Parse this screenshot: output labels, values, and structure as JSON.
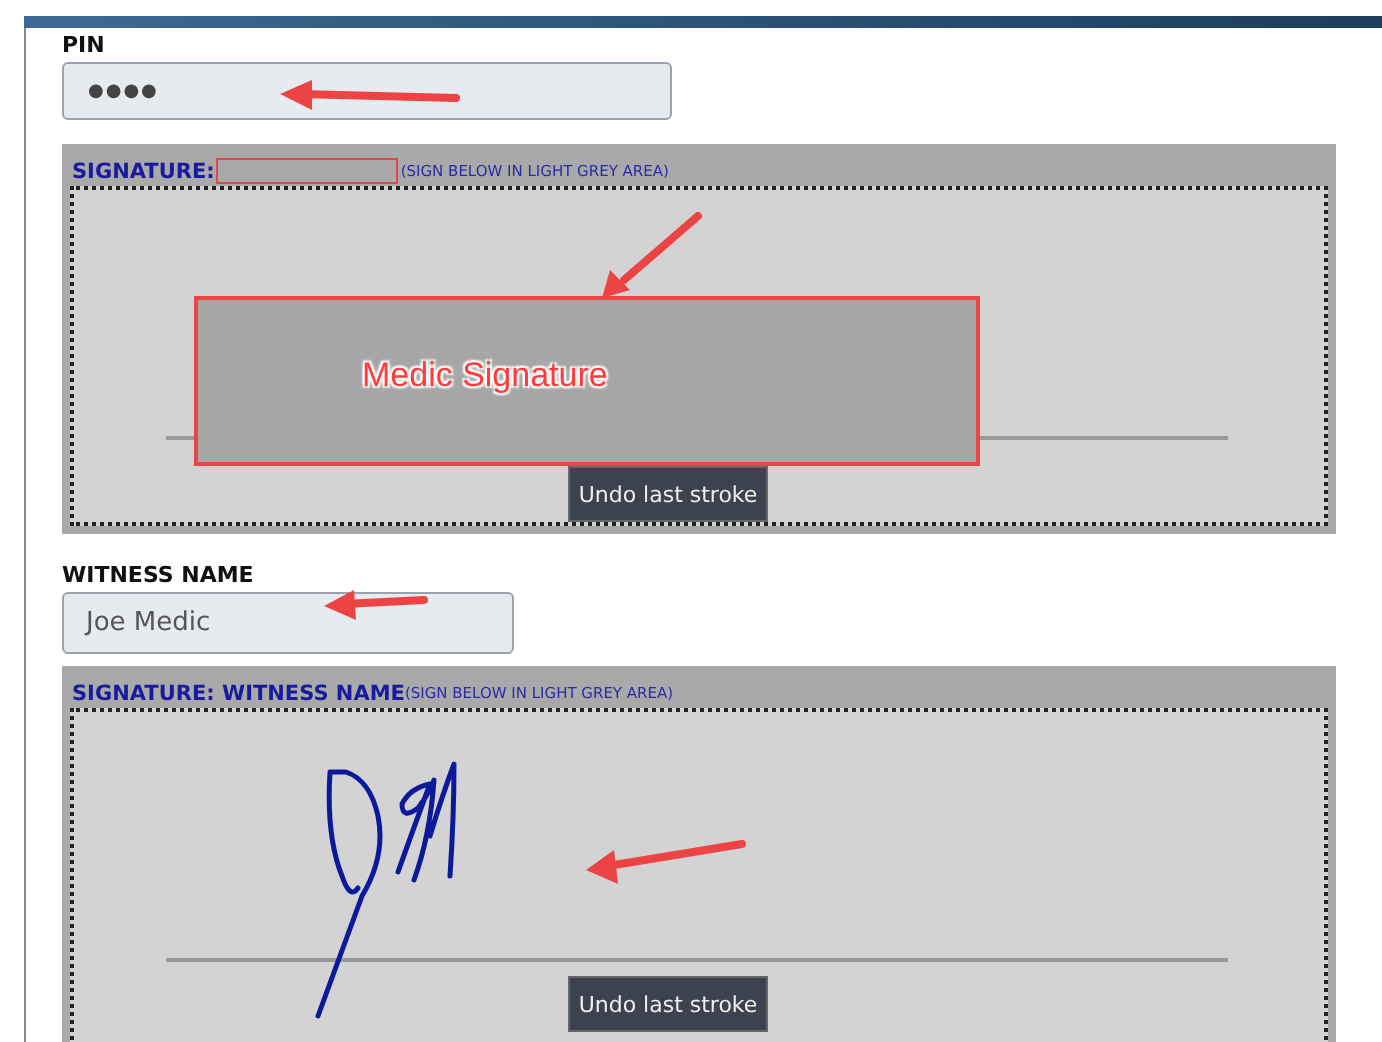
{
  "pin": {
    "label": "PIN",
    "value": "●●●●"
  },
  "signatures": [
    {
      "label": "SIGNATURE:",
      "hint": "(SIGN BELOW IN LIGHT GREY AREA)",
      "redacted": true,
      "signed": false,
      "undo": "Undo last stroke"
    },
    {
      "label": "SIGNATURE: WITNESS NAME",
      "hint": "(SIGN BELOW IN LIGHT GREY AREA)",
      "redacted": false,
      "signed": true,
      "undo": "Undo last stroke"
    }
  ],
  "witness": {
    "label": "WITNESS NAME",
    "value": "Joe Medic"
  },
  "annotations": [
    {
      "text": "Medic Signature"
    }
  ]
}
